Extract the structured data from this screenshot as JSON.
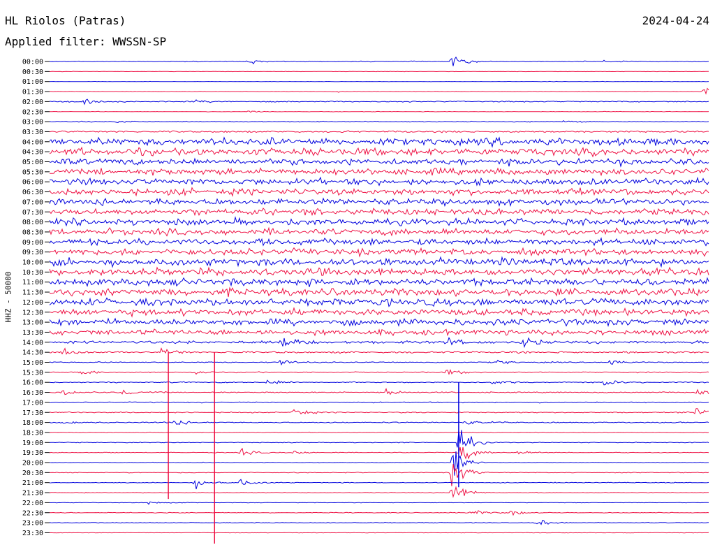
{
  "header": {
    "station": "HL Riolos (Patras)",
    "date": "2024-04-24",
    "filter": "Applied filter: WWSSN-SP"
  },
  "colors": {
    "odd": "#0000dd",
    "even": "#ee1144"
  },
  "chart_data": {
    "type": "helicorder",
    "title": "HL Riolos (Patras)",
    "ylabel": "HHZ - 50000",
    "y_ticks": [
      "00:00",
      "00:30",
      "01:00",
      "01:30",
      "02:00",
      "02:30",
      "03:00",
      "03:30",
      "04:00",
      "04:30",
      "05:00",
      "05:30",
      "06:00",
      "06:30",
      "07:00",
      "07:30",
      "08:00",
      "08:30",
      "09:00",
      "09:30",
      "10:00",
      "10:30",
      "11:00",
      "11:30",
      "12:00",
      "12:30",
      "13:00",
      "13:30",
      "14:00",
      "14:30",
      "15:00",
      "15:30",
      "16:00",
      "16:30",
      "17:00",
      "17:30",
      "18:00",
      "18:30",
      "19:00",
      "19:30",
      "20:00",
      "20:30",
      "21:00",
      "21:30",
      "22:00",
      "22:30",
      "23:00",
      "23:30"
    ],
    "noise_level": [
      1,
      0.4,
      0.4,
      0.6,
      1.2,
      0.5,
      1,
      2,
      8,
      8,
      7,
      7,
      7,
      7,
      7,
      7,
      7,
      7,
      7,
      7,
      8,
      8,
      8,
      8,
      8,
      7,
      7,
      6,
      3,
      2,
      1.2,
      1.2,
      1.2,
      1.2,
      1.2,
      1.2,
      1.2,
      0.8,
      0.8,
      0.8,
      0.8,
      0.8,
      0.8,
      0.8,
      0.5,
      0.8,
      0.8,
      0.5
    ],
    "events": [
      {
        "row": 0,
        "pos": 0.3,
        "amp": 5
      },
      {
        "row": 0,
        "pos": 0.61,
        "amp": 12
      },
      {
        "row": 0,
        "pos": 0.84,
        "amp": 3
      },
      {
        "row": 3,
        "pos": 0.43,
        "amp": 2
      },
      {
        "row": 3,
        "pos": 0.99,
        "amp": 10
      },
      {
        "row": 4,
        "pos": 0.05,
        "amp": 6
      },
      {
        "row": 4,
        "pos": 0.22,
        "amp": 4
      },
      {
        "row": 5,
        "pos": 0.3,
        "amp": 3
      },
      {
        "row": 6,
        "pos": 0.1,
        "amp": 4
      },
      {
        "row": 6,
        "pos": 0.78,
        "amp": 4
      },
      {
        "row": 28,
        "pos": 0.35,
        "amp": 15
      },
      {
        "row": 28,
        "pos": 0.6,
        "amp": 10
      },
      {
        "row": 28,
        "pos": 0.72,
        "amp": 12
      },
      {
        "row": 29,
        "pos": 0.02,
        "amp": 10
      },
      {
        "row": 29,
        "pos": 0.17,
        "amp": 8
      },
      {
        "row": 30,
        "pos": 0.35,
        "amp": 8
      },
      {
        "row": 30,
        "pos": 0.68,
        "amp": 5
      },
      {
        "row": 30,
        "pos": 0.85,
        "amp": 6
      },
      {
        "row": 31,
        "pos": 0.05,
        "amp": 6
      },
      {
        "row": 31,
        "pos": 0.22,
        "amp": 5
      },
      {
        "row": 31,
        "pos": 0.6,
        "amp": 8
      },
      {
        "row": 32,
        "pos": 0.33,
        "amp": 6
      },
      {
        "row": 32,
        "pos": 0.67,
        "amp": 6
      },
      {
        "row": 32,
        "pos": 0.84,
        "amp": 8
      },
      {
        "row": 33,
        "pos": 0.02,
        "amp": 8
      },
      {
        "row": 33,
        "pos": 0.11,
        "amp": 8
      },
      {
        "row": 33,
        "pos": 0.51,
        "amp": 8
      },
      {
        "row": 33,
        "pos": 0.98,
        "amp": 8
      },
      {
        "row": 35,
        "pos": 0.37,
        "amp": 12
      },
      {
        "row": 35,
        "pos": 0.98,
        "amp": 12
      },
      {
        "row": 36,
        "pos": 0.02,
        "amp": 5
      },
      {
        "row": 36,
        "pos": 0.19,
        "amp": 7
      },
      {
        "row": 36,
        "pos": 0.63,
        "amp": 6
      },
      {
        "row": 38,
        "pos": 0.62,
        "amp": 30
      },
      {
        "row": 39,
        "pos": 0.29,
        "amp": 8
      },
      {
        "row": 39,
        "pos": 0.37,
        "amp": 6
      },
      {
        "row": 39,
        "pos": 0.62,
        "amp": 30
      },
      {
        "row": 39,
        "pos": 0.71,
        "amp": 5
      },
      {
        "row": 40,
        "pos": 0.61,
        "amp": 40
      },
      {
        "row": 41,
        "pos": 0.61,
        "amp": 35
      },
      {
        "row": 42,
        "pos": 0.22,
        "amp": 12
      },
      {
        "row": 42,
        "pos": 0.29,
        "amp": 10
      },
      {
        "row": 43,
        "pos": 0.61,
        "amp": 25
      },
      {
        "row": 44,
        "pos": 0.15,
        "amp": 5
      },
      {
        "row": 45,
        "pos": 0.64,
        "amp": 8
      },
      {
        "row": 45,
        "pos": 0.7,
        "amp": 6
      },
      {
        "row": 46,
        "pos": 0.74,
        "amp": 8
      }
    ],
    "spikes": [
      {
        "row": 29,
        "pos": 0.18,
        "len": 210
      },
      {
        "row": 29,
        "pos": 0.25,
        "len": 120
      },
      {
        "row": 31,
        "pos": 0.25,
        "len": 250
      },
      {
        "row": 32,
        "pos": 0.62,
        "len": 150
      }
    ]
  }
}
